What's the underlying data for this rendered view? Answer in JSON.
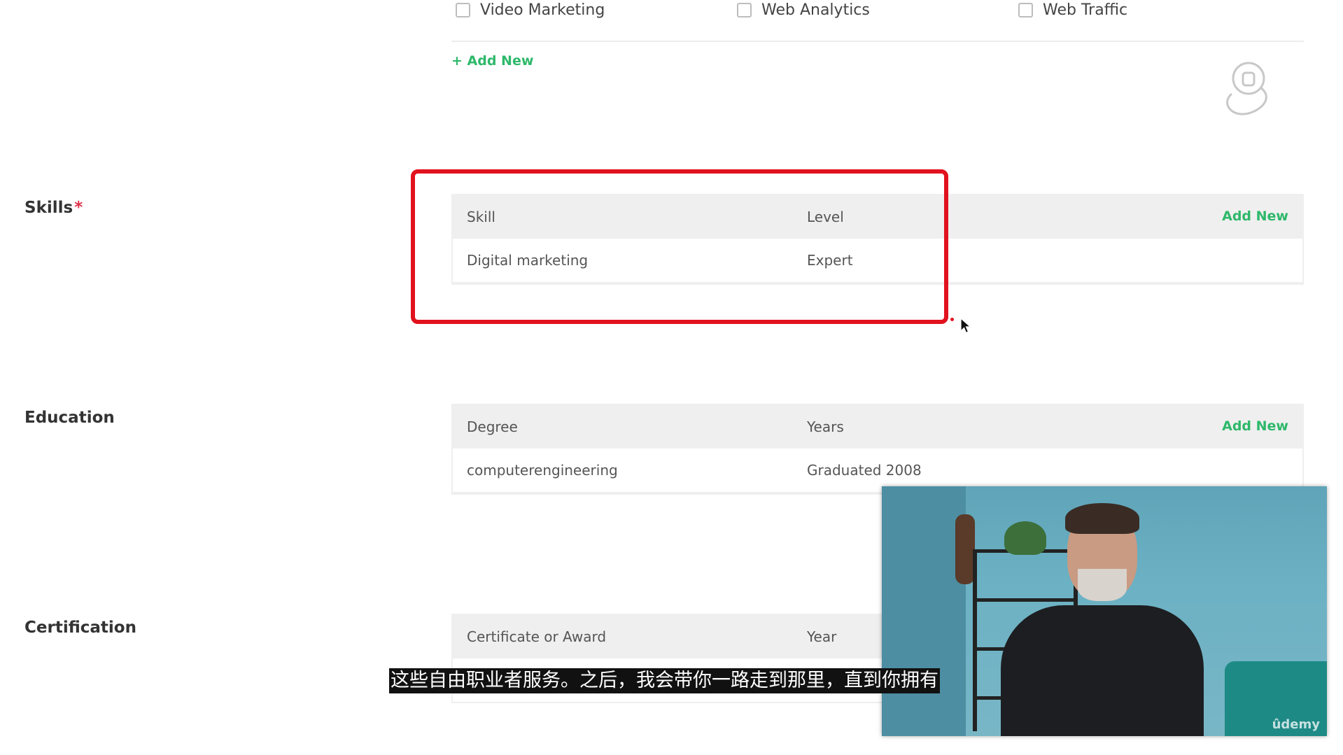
{
  "interests": {
    "checkboxes": [
      {
        "label": "Video Marketing",
        "checked": false
      },
      {
        "label": "Web Analytics",
        "checked": false
      },
      {
        "label": "Web Traffic",
        "checked": false
      }
    ],
    "add_new": "+ Add New"
  },
  "skills": {
    "label": "Skills",
    "required_mark": "*",
    "headers": [
      "Skill",
      "Level"
    ],
    "add_new": "Add New",
    "rows": [
      [
        "Digital marketing",
        "Expert"
      ]
    ]
  },
  "education": {
    "label": "Education",
    "headers": [
      "Degree",
      "Years"
    ],
    "add_new": "Add New",
    "rows": [
      [
        "computerengineering",
        "Graduated 2008"
      ]
    ]
  },
  "certification": {
    "label": "Certification",
    "headers": [
      "Certificate or Award",
      "Year"
    ]
  },
  "subtitle": "这些自由职业者服务。之后，我会带你一路走到那里，直到你拥有",
  "video_watermark": "ûdemy",
  "colors": {
    "accent_green": "#2eb86a",
    "highlight_red": "#e1121e",
    "required_red": "#e0324a"
  }
}
